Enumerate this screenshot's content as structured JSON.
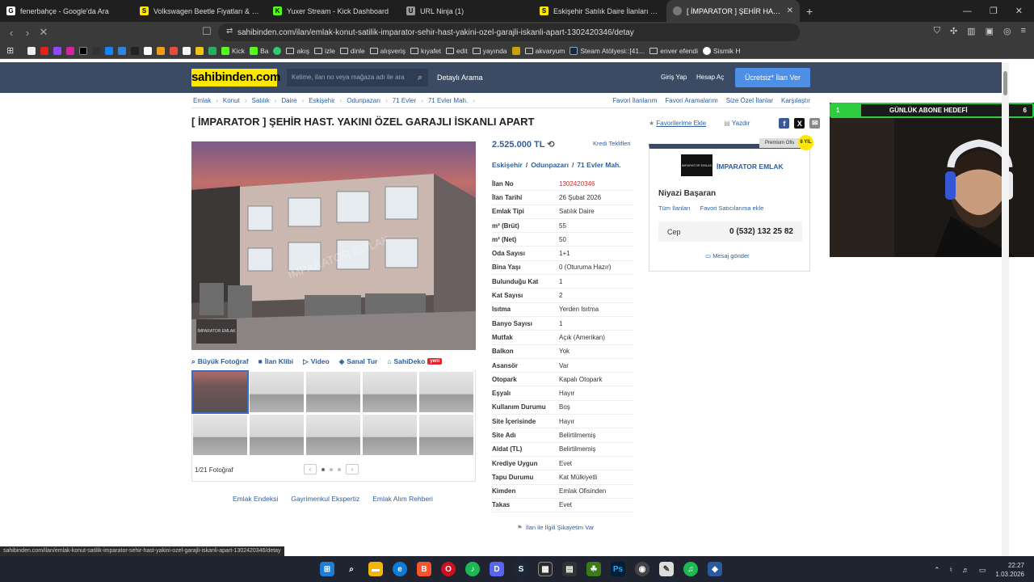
{
  "browser": {
    "tabs": [
      {
        "title": "fenerbahçe - Google'da Ara",
        "color": "#ffffff",
        "glyph": "G"
      },
      {
        "title": "Volkswagen Beetle Fiyatları & Modelleri",
        "color": "#ffe800",
        "glyph": "S"
      },
      {
        "title": "Yuxer Stream - Kick Dashboard",
        "color": "#53fc18",
        "glyph": "K"
      },
      {
        "title": "URL Ninja (1)",
        "color": "#999999",
        "glyph": "U"
      },
      {
        "title": "Eskişehir Satılık Daire İlanları ve Satılık Ev Fiyatları",
        "color": "#ffe800",
        "glyph": "S"
      },
      {
        "title": "[ İMPARATOR ] ŞEHİR HAST. YAKINI ÖZEL GARAJLI İSKANLI APART",
        "color": "#999999",
        "glyph": "•",
        "active": true
      }
    ],
    "url_prefix": "⇄",
    "url": "sahibinden.com/ilan/emlak-konut-satilik-imparator-sehir-hast-yakini-ozel-garajli-iskanli-apart-1302420346/detay",
    "bookmarks": [
      "Kick",
      "Ba",
      "akış",
      "izle",
      "dinle",
      "alışveriş",
      "kıyafet",
      "edit",
      "yayında",
      "akvaryum",
      "Steam Atölyesi::[41...",
      "enver efendi",
      "Sismik H"
    ],
    "status_url": "sahibinden.com/ilan/emlak-konut-satilik-imparator-sehir-hast-yakini-ozel-garajli-iskanli-apart-1302420346/detay"
  },
  "header": {
    "logo": "sahibinden.com",
    "search_placeholder": "Kelime, ilan no veya mağaza adı ile ara",
    "detailed_search": "Detaylı Arama",
    "login": "Giriş Yap",
    "register": "Hesap Aç",
    "cta": "Ücretsiz* İlan Ver"
  },
  "breadcrumb": [
    "Emlak",
    "Konut",
    "Satılık",
    "Daire",
    "Eskişehir",
    "Odunpazarı",
    "71 Evler",
    "71 Evler Mah."
  ],
  "right_links": [
    "Favori İlanlarım",
    "Favori Aramalarım",
    "Size Özel İlanlar",
    "Karşılaştır"
  ],
  "listing": {
    "title": "[ İMPARATOR ] ŞEHİR HAST. YAKINI ÖZEL GARAJLI İSKANLI APART",
    "fav": "Favorilerime Ekle",
    "print": "Yazdır",
    "price": "2.525.000 TL",
    "credit": "Kredi Teklifleri",
    "location": [
      "Eskişehir",
      "Odunpazarı",
      "71 Evler Mah."
    ],
    "details": [
      {
        "k": "İlan No",
        "v": "1302420346",
        "red": true
      },
      {
        "k": "İlan Tarihi",
        "v": "26 Şubat 2026"
      },
      {
        "k": "Emlak Tipi",
        "v": "Satılık Daire"
      },
      {
        "k": "m² (Brüt)",
        "v": "55"
      },
      {
        "k": "m² (Net)",
        "v": "50"
      },
      {
        "k": "Oda Sayısı",
        "v": "1+1"
      },
      {
        "k": "Bina Yaşı",
        "v": "0 (Oturuma Hazır)"
      },
      {
        "k": "Bulunduğu Kat",
        "v": "1"
      },
      {
        "k": "Kat Sayısı",
        "v": "2"
      },
      {
        "k": "Isıtma",
        "v": "Yerden Isıtma"
      },
      {
        "k": "Banyo Sayısı",
        "v": "1"
      },
      {
        "k": "Mutfak",
        "v": "Açık (Amerikan)"
      },
      {
        "k": "Balkon",
        "v": "Yok"
      },
      {
        "k": "Asansör",
        "v": "Var"
      },
      {
        "k": "Otopark",
        "v": "Kapalı Otopark"
      },
      {
        "k": "Eşyalı",
        "v": "Hayır"
      },
      {
        "k": "Kullanım Durumu",
        "v": "Boş"
      },
      {
        "k": "Site İçerisinde",
        "v": "Hayır"
      },
      {
        "k": "Site Adı",
        "v": "Belirtilmemiş"
      },
      {
        "k": "Aidat (TL)",
        "v": "Belirtilmemiş"
      },
      {
        "k": "Krediye Uygun",
        "v": "Evet"
      },
      {
        "k": "Tapu Durumu",
        "v": "Kat Mülkiyetli"
      },
      {
        "k": "Kimden",
        "v": "Emlak Ofisinden"
      },
      {
        "k": "Takas",
        "v": "Evet"
      }
    ],
    "complain": "İlan ile İlgili Şikayetim Var"
  },
  "gallery": {
    "tabs": [
      "Büyük Fotoğraf",
      "İlan Klibi",
      "Video",
      "Sanal Tur",
      "SahiDeko"
    ],
    "new_badge": "yeni",
    "watermark": "İMPARATOR EMLAK",
    "counter": "1/21 Fotoğraf",
    "bottom_links": [
      "Emlak Endeksi",
      "Gayrimenkul Ekspertiz",
      "Emlak Alım Rehberi"
    ]
  },
  "seller": {
    "premium": "Premium Ofis",
    "badge": "8 YIL",
    "logo_text": "İMPARATOR EMLAK",
    "store": "İMPARATOR EMLAK",
    "person": "Niyazi Başaran",
    "all_listings": "Tüm İlanları",
    "fav_seller": "Favori Satıcılarıma ekle",
    "phone_label": "Cep",
    "phone": "0 (532) 132 25 82",
    "message": "Mesaj gönder"
  },
  "overlay": {
    "goal_left": "1",
    "goal_title": "GÜNLÜK ABONE HEDEFİ",
    "goal_right": "6",
    "progress_fraction": 0.15
  },
  "taskbar": {
    "time": "22:27",
    "date": "1.03.2026"
  }
}
